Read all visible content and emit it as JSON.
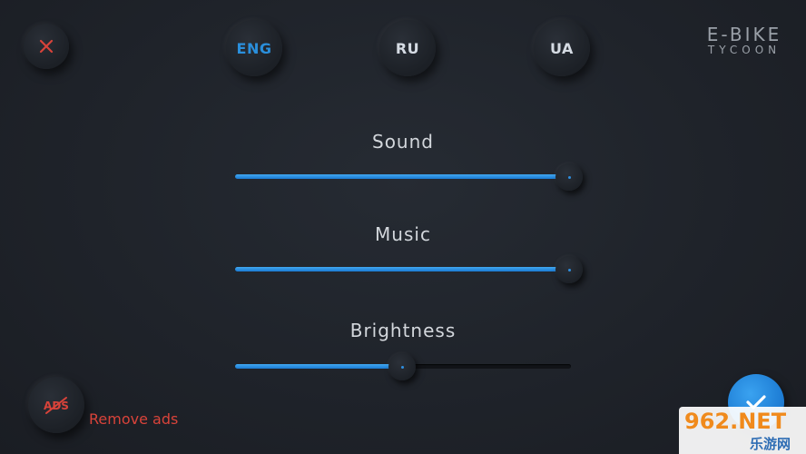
{
  "header": {
    "close_icon": "close-icon",
    "languages": [
      {
        "label": "ENG",
        "active": true
      },
      {
        "label": "RU",
        "active": false
      },
      {
        "label": "UA",
        "active": false
      }
    ],
    "logo": {
      "main": "E-BIKE",
      "sub": "TYCOON"
    }
  },
  "settings": {
    "sound": {
      "label": "Sound",
      "level": 1.0
    },
    "music": {
      "label": "Music",
      "level": 1.0
    },
    "brightness": {
      "label": "Brightness",
      "level": 0.5
    }
  },
  "footer": {
    "remove_ads_label": "Remove ads",
    "ads_icon": "no-ads-icon",
    "confirm_icon": "checkmark-icon"
  },
  "watermark": {
    "main": "962.NET",
    "sub": "乐游网"
  },
  "colors": {
    "accent": "#2a8fdc",
    "danger": "#d8433a",
    "text": "#d3d7dc",
    "background": "#1f232a"
  }
}
